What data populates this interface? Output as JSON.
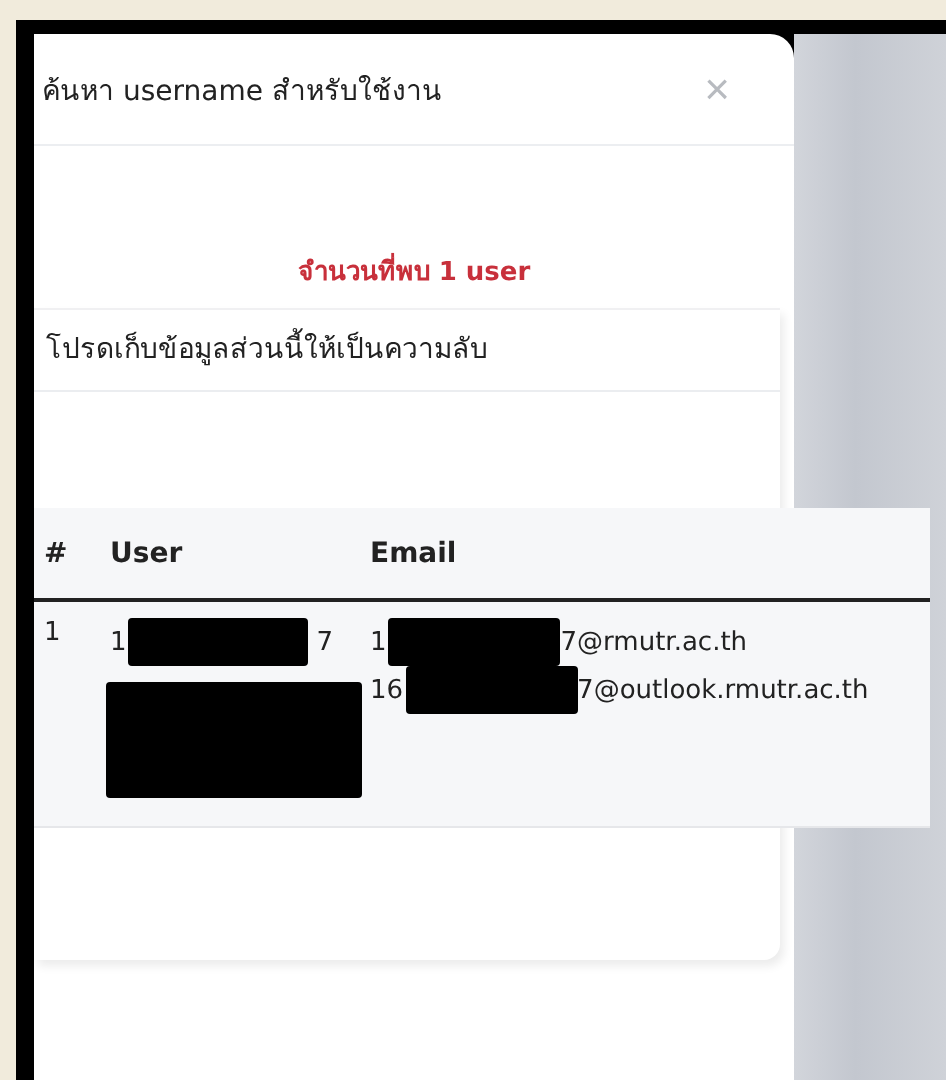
{
  "dialog": {
    "title": "ค้นหา username สำหรับใช้งาน",
    "close": "×"
  },
  "result_count": "จำนวนที่พบ 1 user",
  "card": {
    "title": "โปรดเก็บข้อมูลส่วนนี้ให้เป็นความลับ"
  },
  "table": {
    "columns": [
      "#",
      "User",
      "Email"
    ],
    "rows": [
      {
        "index": "1",
        "user": [
          {
            "kind": "partial",
            "prefix": "1",
            "suffix": "7"
          },
          {
            "kind": "redacted"
          }
        ],
        "emails": [
          {
            "prefix": "1",
            "suffix": "7@rmutr.ac.th"
          },
          {
            "prefix": "16",
            "suffix": "7@outlook.rmutr.ac.th"
          }
        ]
      }
    ]
  }
}
